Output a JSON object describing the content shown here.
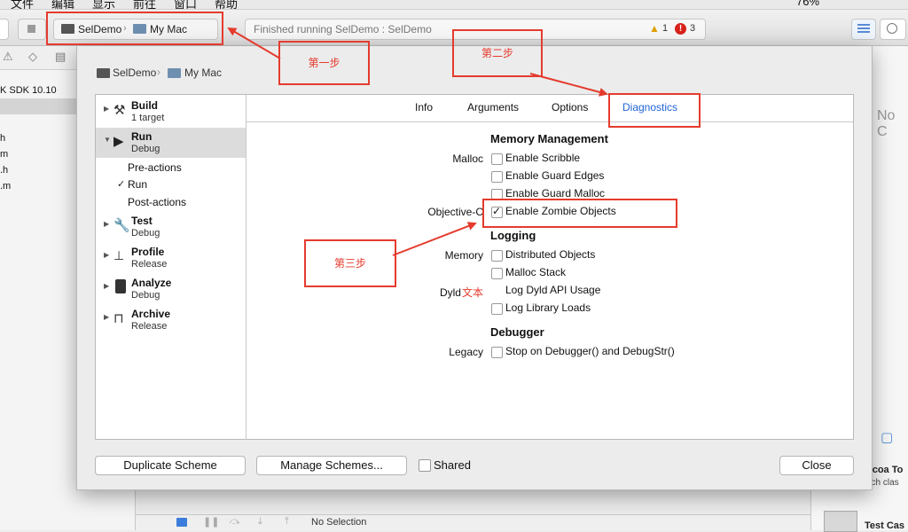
{
  "menubar": {
    "items": [
      "文件",
      "编辑",
      "显示",
      "前往",
      "窗口",
      "帮助"
    ],
    "battery": "76%"
  },
  "toolbar": {
    "scheme_project": "SelDemo",
    "scheme_target": "My Mac",
    "status_text": "Finished running SelDemo : SelDemo",
    "warnings_count": "1",
    "errors_count": "3"
  },
  "navigator": {
    "items": [
      "K SDK 10.10",
      "h",
      "m",
      ".h",
      ".m"
    ]
  },
  "inspector": {
    "no_selection": "No C",
    "cocoa_title": "ocoa To",
    "cocoa_sub": "uch clas",
    "test_case": "Test Cas"
  },
  "debugbar": {
    "status": "No Selection"
  },
  "sheet": {
    "breadcrumb_project": "SelDemo",
    "breadcrumb_target": "My Mac",
    "actions": [
      {
        "name": "Build",
        "sub": "1 target"
      },
      {
        "name": "Run",
        "sub": "Debug"
      },
      {
        "name": "Test",
        "sub": "Debug"
      },
      {
        "name": "Profile",
        "sub": "Release"
      },
      {
        "name": "Analyze",
        "sub": "Debug"
      },
      {
        "name": "Archive",
        "sub": "Release"
      }
    ],
    "run_subactions": [
      "Pre-actions",
      "Run",
      "Post-actions"
    ],
    "tabs": [
      "Info",
      "Arguments",
      "Options",
      "Diagnostics"
    ],
    "memory_management": {
      "title": "Memory Management",
      "malloc_label": "Malloc",
      "enable_scribble": "Enable Scribble",
      "enable_guard_edges": "Enable Guard Edges",
      "enable_guard_malloc": "Enable Guard Malloc",
      "objc_label": "Objective-C",
      "enable_zombie": "Enable Zombie Objects"
    },
    "logging": {
      "title": "Logging",
      "memory_label": "Memory",
      "distributed_objects": "Distributed Objects",
      "malloc_stack": "Malloc Stack",
      "dyld_label": "Dyld",
      "dyld_overlay": "文本",
      "log_dyld_api": "Log Dyld API Usage",
      "log_library_loads": "Log Library Loads"
    },
    "debugger": {
      "title": "Debugger",
      "legacy_label": "Legacy",
      "stop_on_debugger": "Stop on Debugger() and DebugStr()"
    },
    "buttons": {
      "duplicate": "Duplicate Scheme",
      "manage": "Manage Schemes...",
      "shared": "Shared",
      "close": "Close"
    }
  },
  "annotations": {
    "step1": "第一步",
    "step2": "第二步",
    "step3": "第三步"
  },
  "colors": {
    "annotation_red": "#e53b2e",
    "active_tab_blue": "#1f62d8"
  }
}
